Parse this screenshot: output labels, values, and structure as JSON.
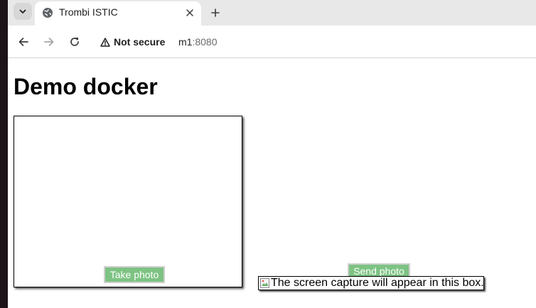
{
  "browser": {
    "tab": {
      "title": "Trombi ISTIC"
    },
    "security_chip": "Not secure",
    "url": {
      "host": "m1",
      "port": ":8080"
    }
  },
  "page": {
    "title": "Demo docker",
    "take_photo_label": "Take photo",
    "send_photo_label": "Send photo",
    "capture_alt_text": "The screen capture will appear in this box."
  }
}
